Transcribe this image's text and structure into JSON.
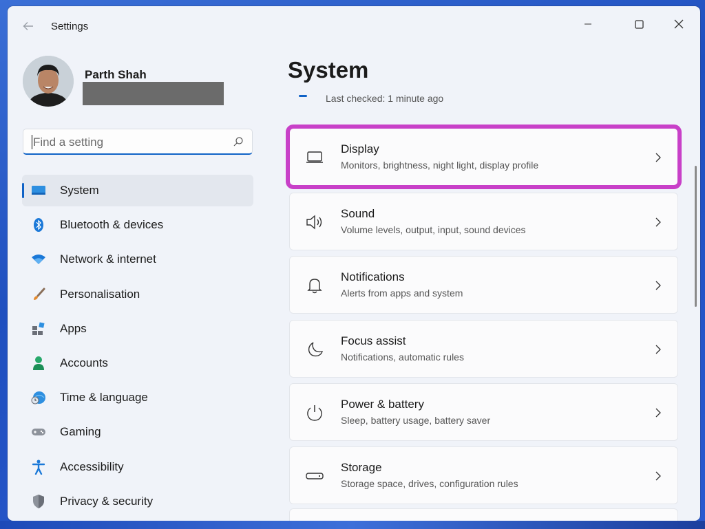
{
  "window": {
    "title": "Settings"
  },
  "user": {
    "name": "Parth Shah"
  },
  "search": {
    "placeholder": "Find a setting"
  },
  "sidebar": {
    "items": [
      {
        "label": "System",
        "icon": "system-icon",
        "active": true
      },
      {
        "label": "Bluetooth & devices",
        "icon": "bluetooth-icon"
      },
      {
        "label": "Network & internet",
        "icon": "wifi-icon"
      },
      {
        "label": "Personalisation",
        "icon": "brush-icon"
      },
      {
        "label": "Apps",
        "icon": "apps-icon"
      },
      {
        "label": "Accounts",
        "icon": "accounts-icon"
      },
      {
        "label": "Time & language",
        "icon": "globe-clock-icon"
      },
      {
        "label": "Gaming",
        "icon": "gamepad-icon"
      },
      {
        "label": "Accessibility",
        "icon": "accessibility-icon"
      },
      {
        "label": "Privacy & security",
        "icon": "shield-icon"
      }
    ]
  },
  "main": {
    "title": "System",
    "last_checked": "Last checked: 1 minute ago",
    "cards": [
      {
        "title": "Display",
        "subtitle": "Monitors, brightness, night light, display profile",
        "icon": "monitor-icon",
        "highlighted": true
      },
      {
        "title": "Sound",
        "subtitle": "Volume levels, output, input, sound devices",
        "icon": "speaker-icon"
      },
      {
        "title": "Notifications",
        "subtitle": "Alerts from apps and system",
        "icon": "bell-icon"
      },
      {
        "title": "Focus assist",
        "subtitle": "Notifications, automatic rules",
        "icon": "moon-icon"
      },
      {
        "title": "Power & battery",
        "subtitle": "Sleep, battery usage, battery saver",
        "icon": "power-icon"
      },
      {
        "title": "Storage",
        "subtitle": "Storage space, drives, configuration rules",
        "icon": "storage-icon"
      }
    ]
  },
  "colors": {
    "accent": "#0f62c6",
    "highlight": "#c840c8",
    "window_bg": "#f0f3f9"
  }
}
